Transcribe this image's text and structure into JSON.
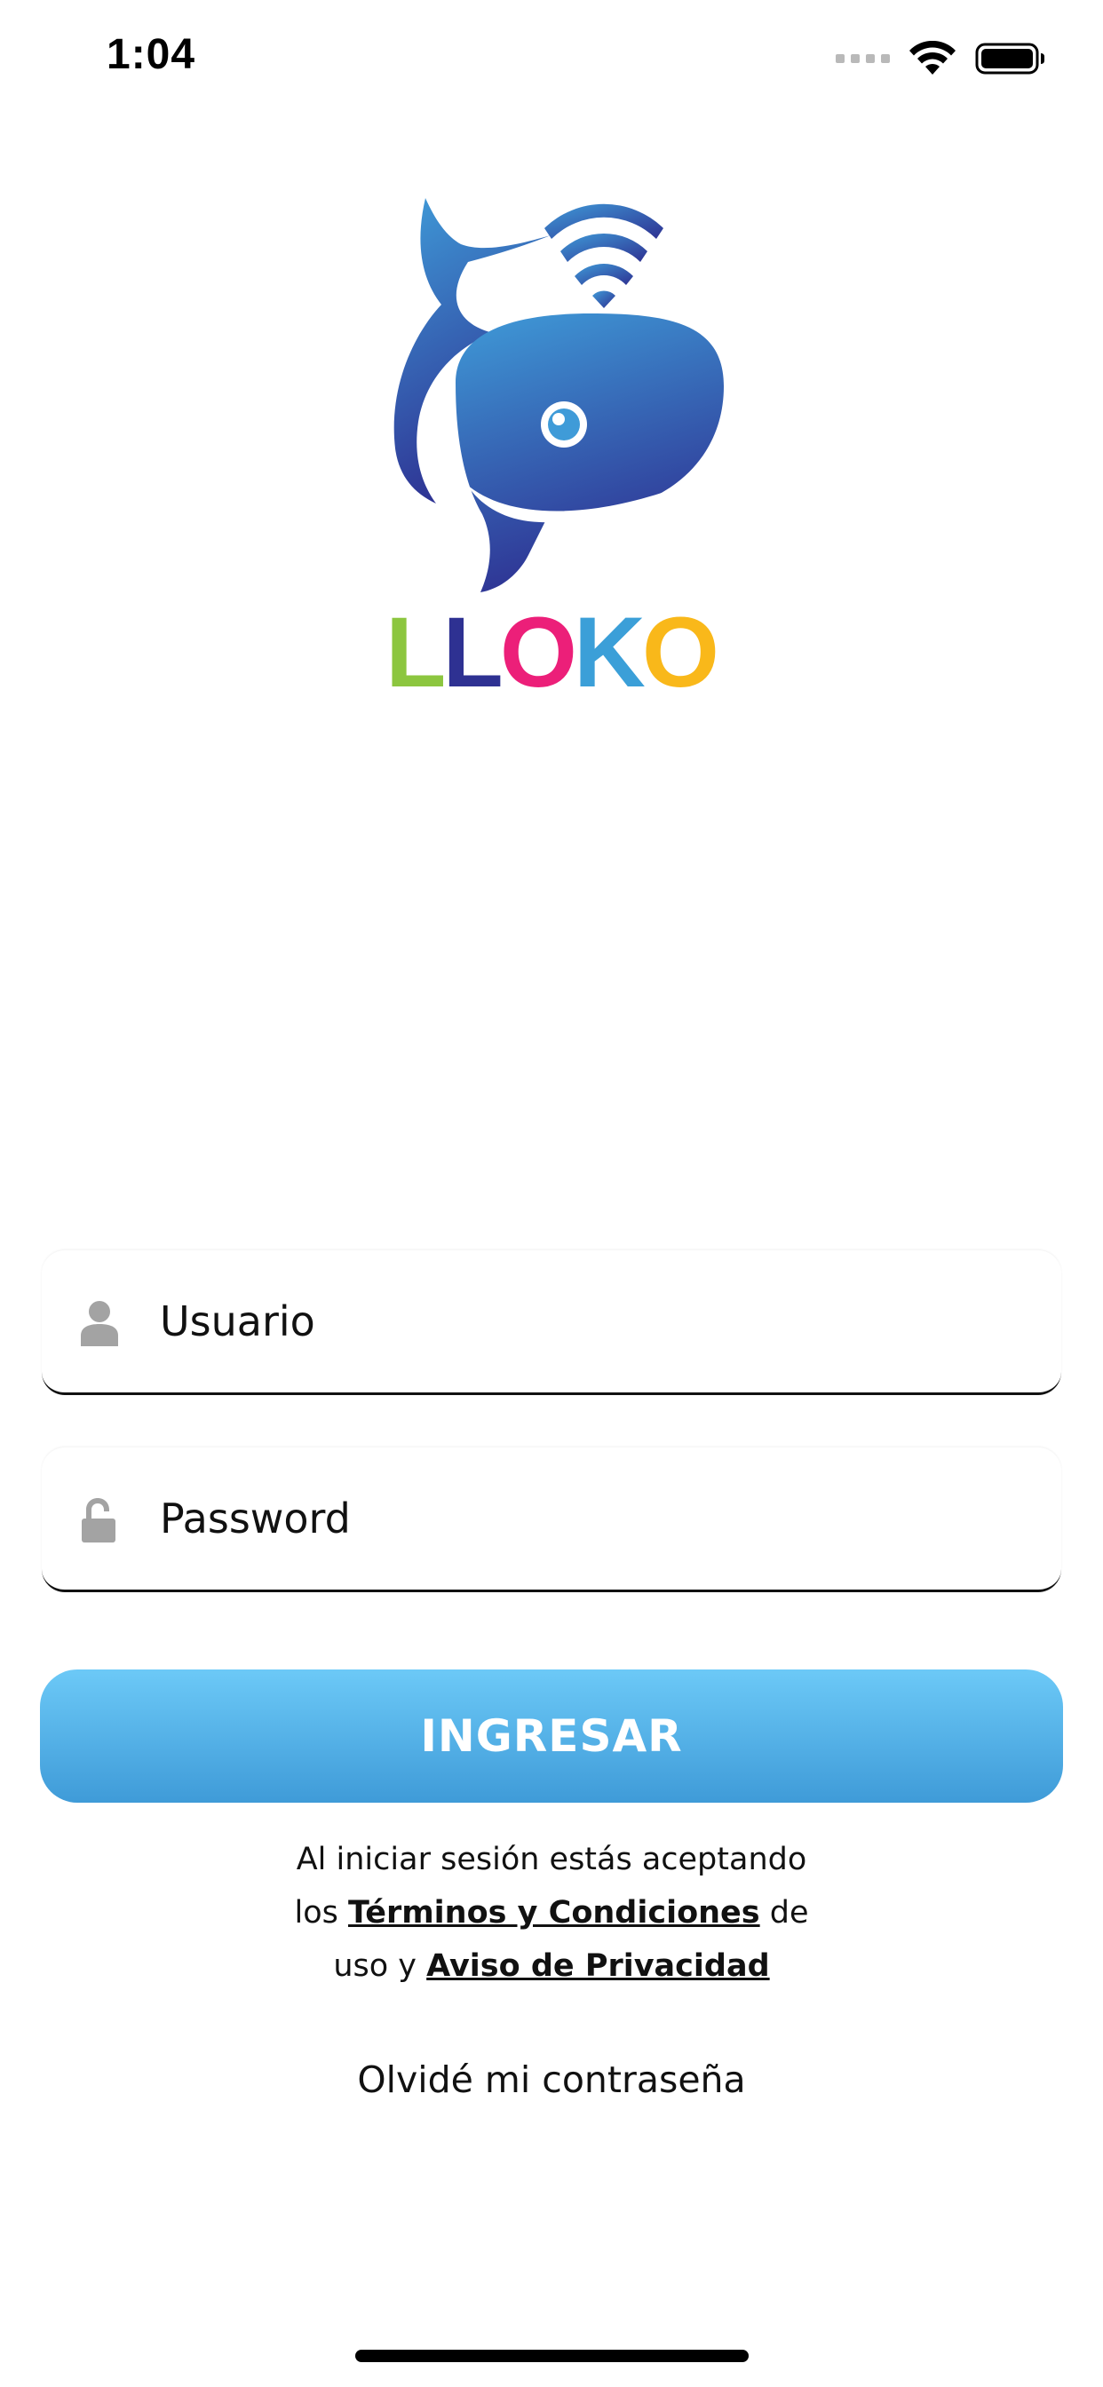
{
  "status_bar": {
    "time": "1:04"
  },
  "logo": {
    "brand_letters": [
      {
        "char": "L",
        "color": "#8cc63f"
      },
      {
        "char": "L",
        "color": "#2e3192"
      },
      {
        "char": "O",
        "color": "#ec1f79"
      },
      {
        "char": "K",
        "color": "#3b9fd8"
      },
      {
        "char": "O",
        "color": "#f9b81a"
      }
    ],
    "whale_color_top": "#3f9bd8",
    "whale_color_bottom": "#2e3192"
  },
  "form": {
    "username": {
      "placeholder": "Usuario",
      "icon": "user-icon",
      "value": ""
    },
    "password": {
      "placeholder": "Password",
      "icon": "unlock-icon",
      "value": ""
    },
    "submit_label": "INGRESAR",
    "button_gradient": [
      "#6cc9f7",
      "#3f9bd8"
    ]
  },
  "terms": {
    "line1": "Al iniciar sesión estás aceptando",
    "line2_prefix": "los",
    "terms_link": "Términos y Condiciones",
    "line2_suffix": "de",
    "line3_prefix": "uso y",
    "privacy_link": "Aviso de Privacidad"
  },
  "forgot_password": "Olvidé mi contraseña"
}
